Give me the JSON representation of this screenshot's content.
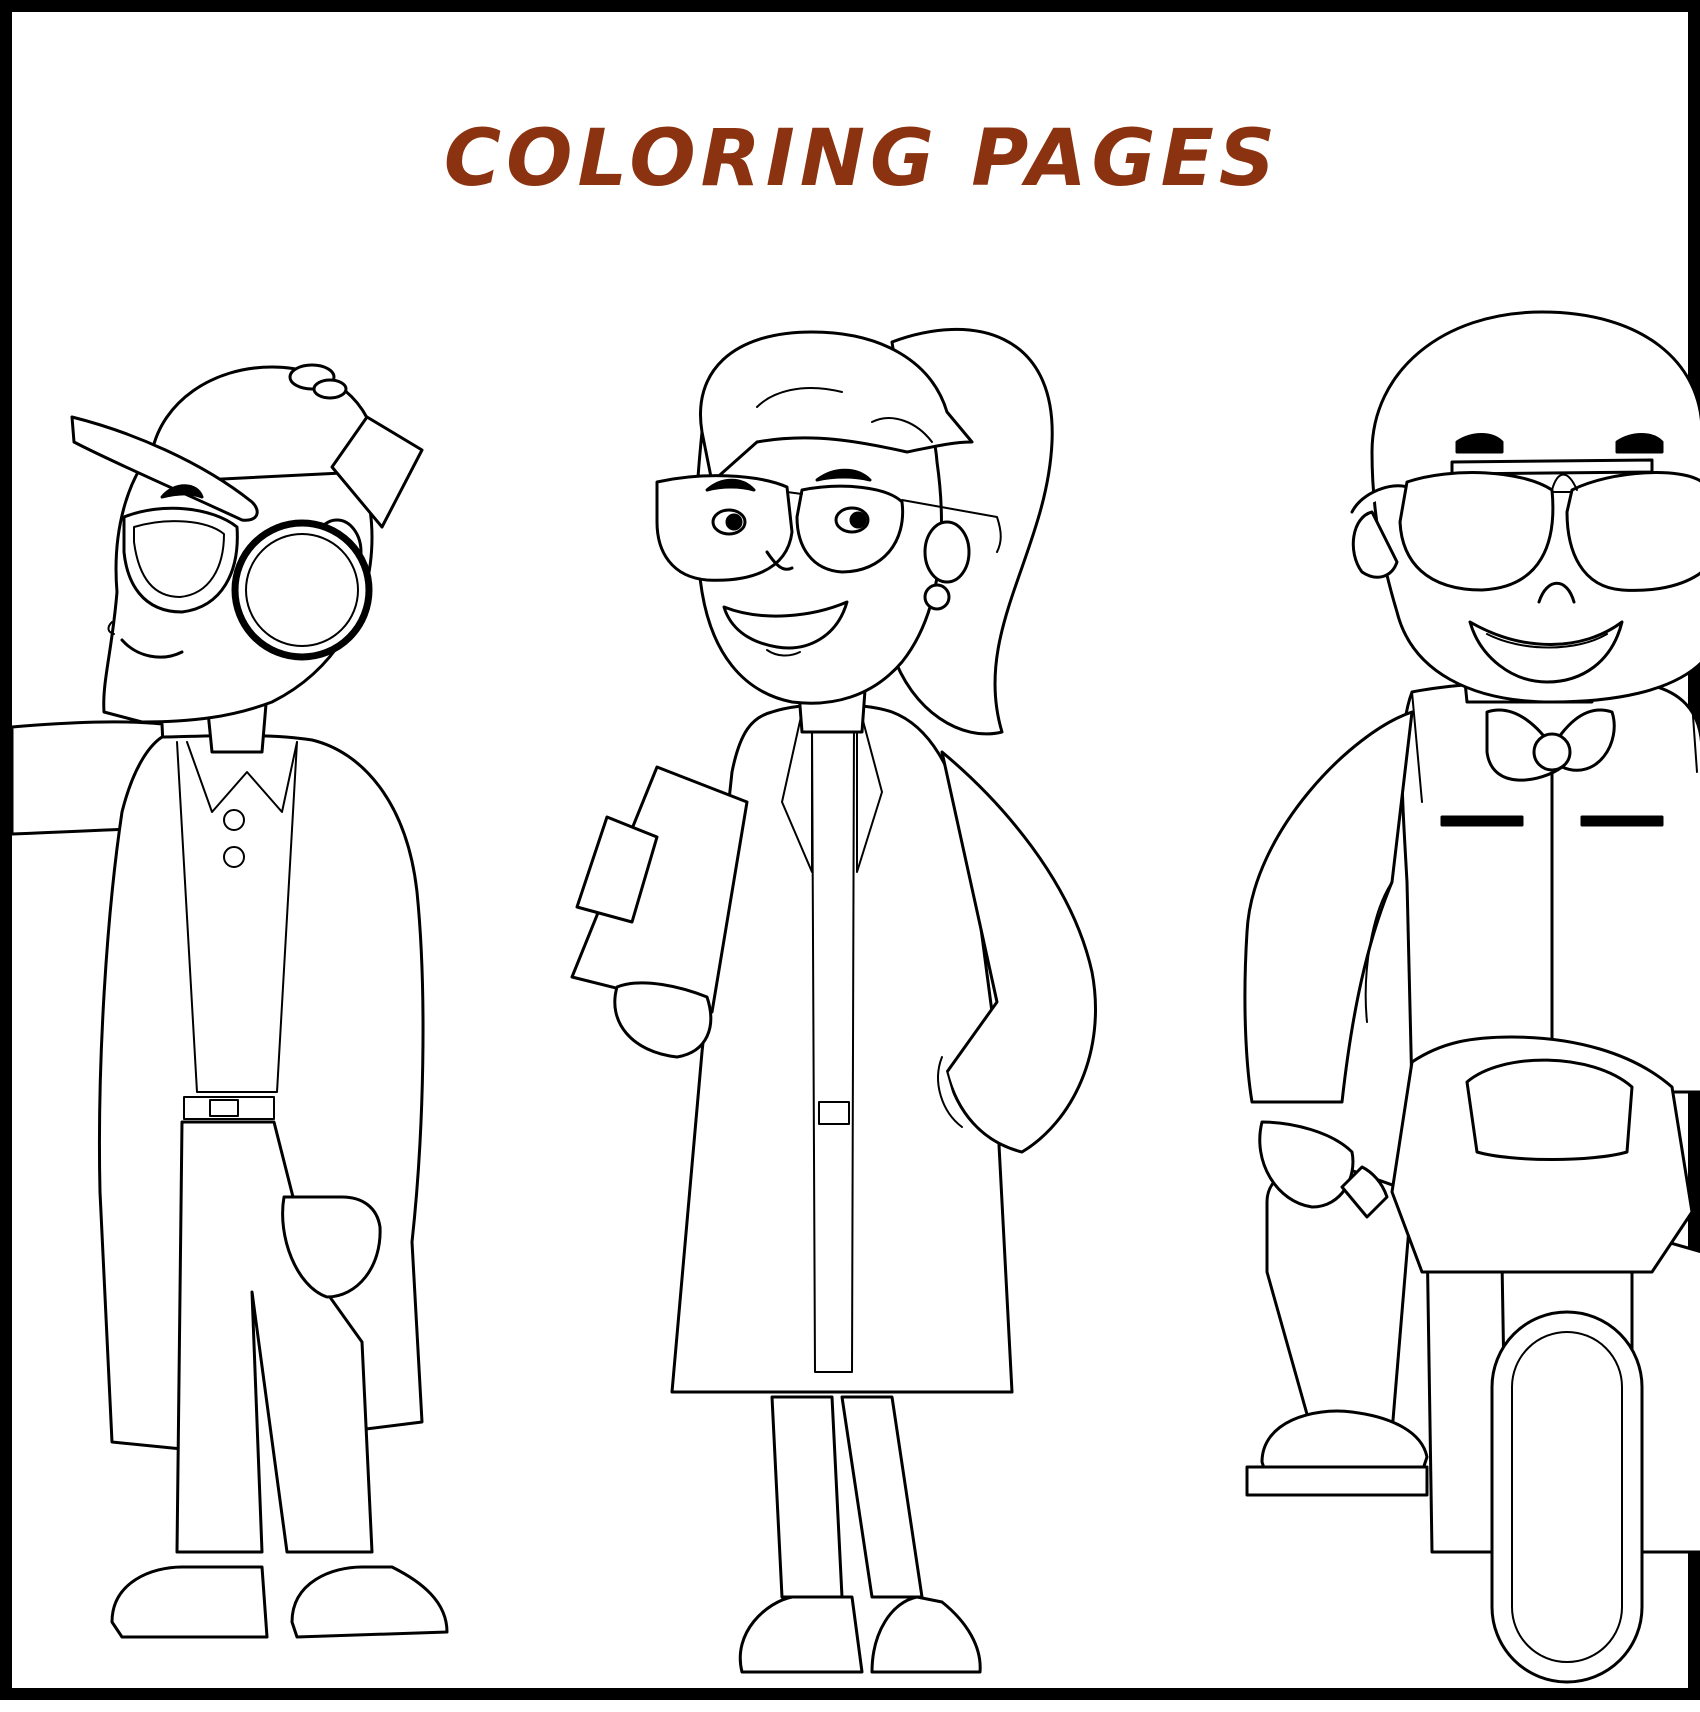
{
  "page": {
    "title": "COLORING PAGES",
    "title_color": "#8b3310",
    "border_color": "#000000",
    "background": "#ffffff"
  },
  "figures": [
    {
      "name": "scientist-with-cap-and-goggles",
      "icon": "person-outline"
    },
    {
      "name": "scientist-woman-with-clipboard",
      "icon": "person-outline"
    },
    {
      "name": "child-on-motorbike",
      "icon": "person-outline"
    }
  ]
}
